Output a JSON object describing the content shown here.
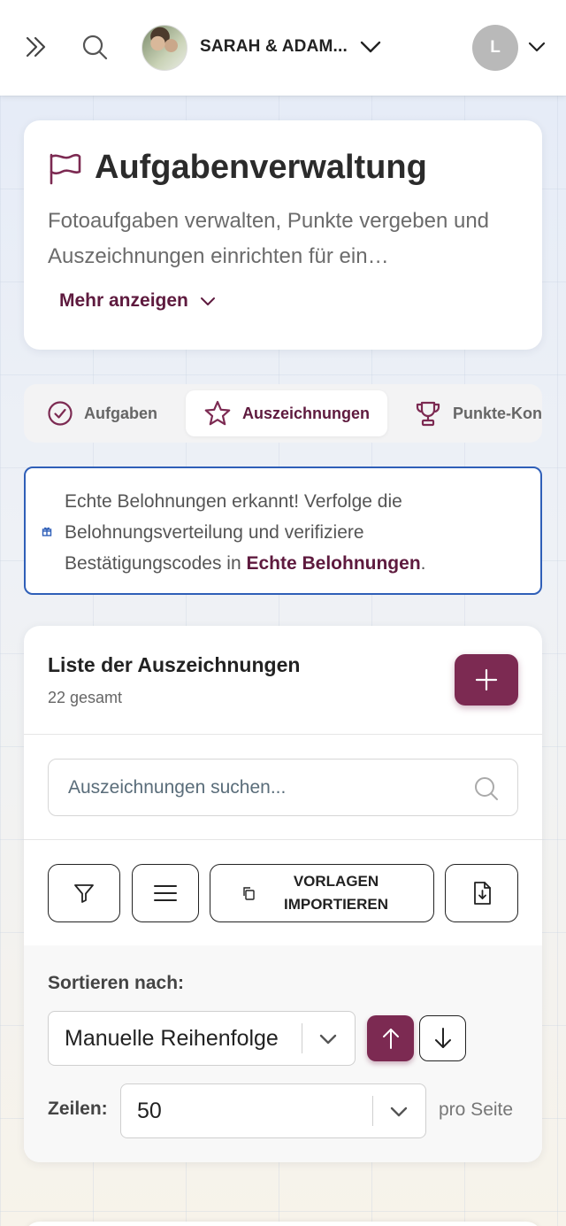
{
  "header": {
    "couple_name": "SARAH & ADAM...",
    "user_initial": "L"
  },
  "intro": {
    "title": "Aufgabenverwaltung",
    "description": "Fotoaufgaben verwalten, Punkte vergeben und Auszeichnungen einrichten für ein…",
    "more_label": "Mehr anzeigen"
  },
  "tabs": [
    {
      "label": "Aufgaben",
      "icon": "check-circle-icon",
      "active": false
    },
    {
      "label": "Auszeichnungen",
      "icon": "star-icon",
      "active": true
    },
    {
      "label": "Punkte-Kon",
      "icon": "trophy-icon",
      "active": false
    }
  ],
  "alert": {
    "text": "Echte Belohnungen erkannt! Verfolge die Belohnungsverteilung und verifiziere Bestätigungscodes in ",
    "link": "Echte Belohnungen",
    "end": "."
  },
  "list": {
    "title": "Liste der Auszeichnungen",
    "count": "22 gesamt",
    "search_placeholder": "Auszeichnungen suchen...",
    "templates_label": "VORLAGEN IMPORTIEREN"
  },
  "sort": {
    "label": "Sortieren nach:",
    "selected": "Manuelle Reihenfolge",
    "rows_label": "Zeilen:",
    "rows_value": "50",
    "per_page": "pro Seite"
  },
  "colors": {
    "brand": "#7c2a52",
    "brand_text": "#5e1a3e",
    "alert_border": "#2f5fb8"
  }
}
